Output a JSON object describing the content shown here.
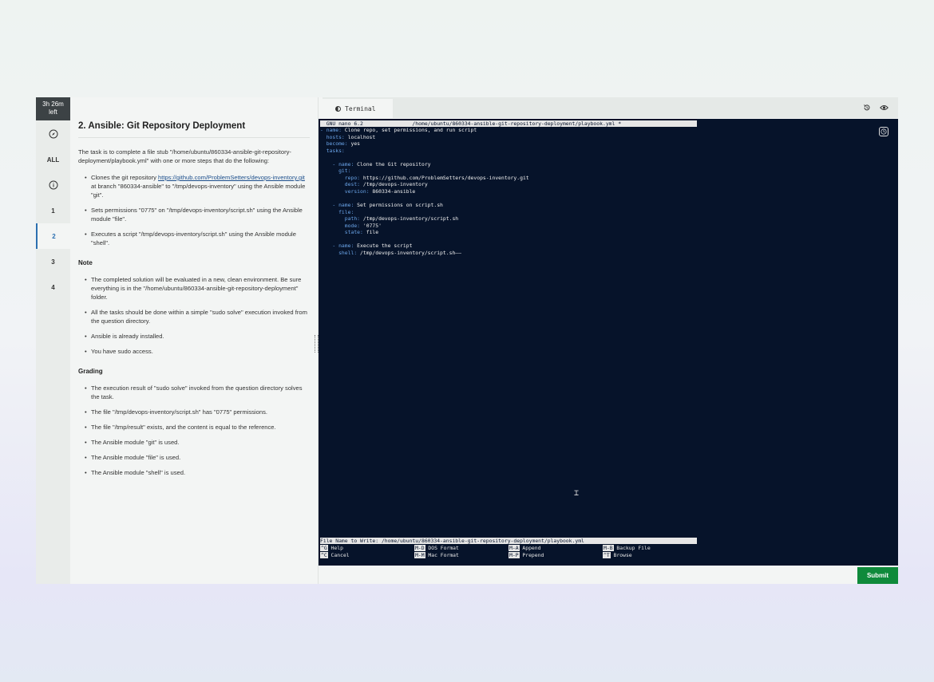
{
  "timer": {
    "line1": "3h 26m",
    "line2": "left"
  },
  "nav": {
    "all_label": "ALL",
    "items": [
      "1",
      "2",
      "3",
      "4"
    ]
  },
  "question": {
    "title": "2. Ansible: Git Repository Deployment",
    "intro": "The task is to complete a file stub \"/home/ubuntu/860334-ansible-git-repository-deployment/playbook.yml\" with one or more steps that do the following:",
    "task_prefix": "Clones the git repository ",
    "task_link": "https://github.com/ProblemSetters/devops-inventory.git",
    "task_suffix": " at branch \"860334-ansible\" to \"/tmp/devops-inventory\" using the Ansible module \"git\".",
    "tasks": [
      "Sets permissions \"0775\" on \"/tmp/devops-inventory/script.sh\" using the Ansible module \"file\".",
      "Executes a script \"/tmp/devops-inventory/script.sh\" using the Ansible module \"shell\"."
    ],
    "note_heading": "Note",
    "notes": [
      "The completed solution will be evaluated in a new, clean environment. Be sure everything is in the \"/home/ubuntu/860334-ansible-git-repository-deployment\" folder.",
      "All the tasks should be done within a simple \"sudo solve\" execution invoked from the question directory.",
      "Ansible is already installed.",
      "You have sudo access."
    ],
    "grading_heading": "Grading",
    "grading": [
      "The execution result of \"sudo solve\" invoked from the question directory solves the task.",
      "The file \"/tmp/devops-inventory/script.sh\" has \"0775\" permissions.",
      "The file \"/tmp/result\" exists, and the content is equal to the reference.",
      "The Ansible module \"git\" is used.",
      "The Ansible module \"file\" is used.",
      "The Ansible module \"shell\" is used."
    ]
  },
  "terminal": {
    "tab_label": "Terminal",
    "nano_title": "  GNU nano 6.2                /home/ubuntu/860334-ansible-git-repository-deployment/playbook.yml *",
    "lines": [
      {
        "k": "- name:",
        "v": " Clone repo, set permissions, and run script"
      },
      {
        "k": "  hosts:",
        "v": " localhost"
      },
      {
        "k": "  become:",
        "v": " yes"
      },
      {
        "k": "  tasks:",
        "v": ""
      },
      {
        "k": "",
        "v": ""
      },
      {
        "k": "    - name:",
        "v": " Clone the Git repository"
      },
      {
        "k": "      git:",
        "v": ""
      },
      {
        "k": "        repo:",
        "v": " https://github.com/ProblemSetters/devops-inventory.git"
      },
      {
        "k": "        dest:",
        "v": " /tmp/devops-inventory"
      },
      {
        "k": "        version:",
        "v": " 860334-ansible"
      },
      {
        "k": "",
        "v": ""
      },
      {
        "k": "    - name:",
        "v": " Set permissions on script.sh"
      },
      {
        "k": "      file:",
        "v": ""
      },
      {
        "k": "        path:",
        "v": " /tmp/devops-inventory/script.sh"
      },
      {
        "k": "        mode:",
        "v": " '0775'"
      },
      {
        "k": "        state:",
        "v": " file"
      },
      {
        "k": "",
        "v": ""
      },
      {
        "k": "    - name:",
        "v": " Execute the script"
      },
      {
        "k": "      shell:",
        "v": " /tmp/devops-inventory/script.sh——"
      }
    ],
    "prompt": "File Name to Write: /home/ubuntu/860334-ansible-git-repository-deployment/playbook.yml",
    "shortcuts_row1": [
      {
        "key": "^G",
        "label": "Help"
      },
      {
        "key": "M-D",
        "label": "DOS Format"
      },
      {
        "key": "M-A",
        "label": "Append"
      },
      {
        "key": "M-B",
        "label": "Backup File"
      }
    ],
    "shortcuts_row2": [
      {
        "key": "^C",
        "label": "Cancel"
      },
      {
        "key": "M-M",
        "label": "Mac Format"
      },
      {
        "key": "M-P",
        "label": "Prepend"
      },
      {
        "key": "^T",
        "label": "Browse"
      }
    ]
  },
  "submit_label": "Submit"
}
